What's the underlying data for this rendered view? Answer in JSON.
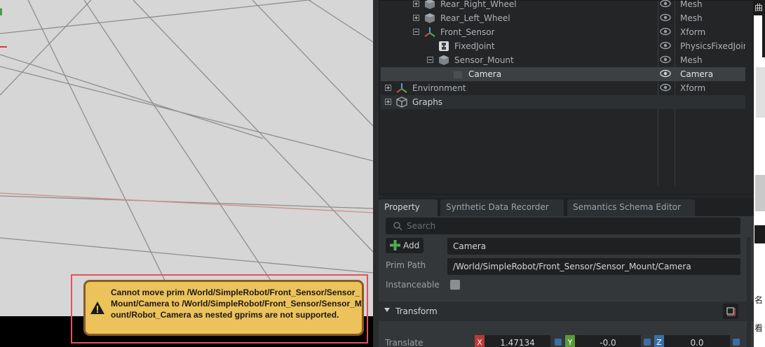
{
  "stage_tree": {
    "rows": [
      {
        "name": "Rear_Right_Wheel",
        "type": "Mesh",
        "icon": "mesh-cube-icon",
        "expander": "plus"
      },
      {
        "name": "Rear_Left_Wheel",
        "type": "Mesh",
        "icon": "mesh-cube-icon",
        "expander": "plus"
      },
      {
        "name": "Front_Sensor",
        "type": "Xform",
        "icon": "xform-axes-icon",
        "expander": "minus"
      },
      {
        "name": "FixedJoint",
        "type": "PhysicsFixedJoint",
        "icon": "joint-icon",
        "expander": "none"
      },
      {
        "name": "Sensor_Mount",
        "type": "Mesh",
        "icon": "mesh-cube-icon",
        "expander": "minus"
      },
      {
        "name": "Camera",
        "type": "Camera",
        "icon": "camera-icon",
        "expander": "none",
        "selected": true
      },
      {
        "name": "Environment",
        "type": "Xform",
        "icon": "xform-axes-icon",
        "expander": "plus"
      },
      {
        "name": "Graphs",
        "type": "",
        "icon": "scope-cube-icon",
        "expander": "plus"
      }
    ]
  },
  "tabs": [
    "Property",
    "Synthetic Data Recorder",
    "Semantics Schema Editor"
  ],
  "property": {
    "search_placeholder": "Search",
    "add_label": "Add",
    "name_value": "Camera",
    "prim_path_label": "Prim Path",
    "prim_path_value": "/World/SimpleRobot/Front_Sensor/Sensor_Mount/Camera",
    "instanceable_label": "Instanceable",
    "transform_label": "Transform",
    "translate_label": "Translate",
    "translate": {
      "x_label": "X",
      "x": "1.47134",
      "y_label": "Y",
      "y": "-0.0",
      "z_label": "Z",
      "z": "0.0"
    }
  },
  "notification": {
    "text": "Cannot move prim /World/SimpleRobot/Front_Sensor/Sensor_Mount/Camera to /World/SimpleRobot/Front_Sensor/Sensor_Mount/Robot_Camera as nested gprims are not supported."
  },
  "far_right": {
    "glyph1": "曲",
    "glyph2": "名",
    "glyph3": "看"
  },
  "colors": {
    "warning_bg": "#ecc25a",
    "highlight_border": "#e4525a",
    "axis_x": "#b83a3a",
    "axis_y": "#5a9a3a",
    "axis_z": "#3b6ea5"
  }
}
